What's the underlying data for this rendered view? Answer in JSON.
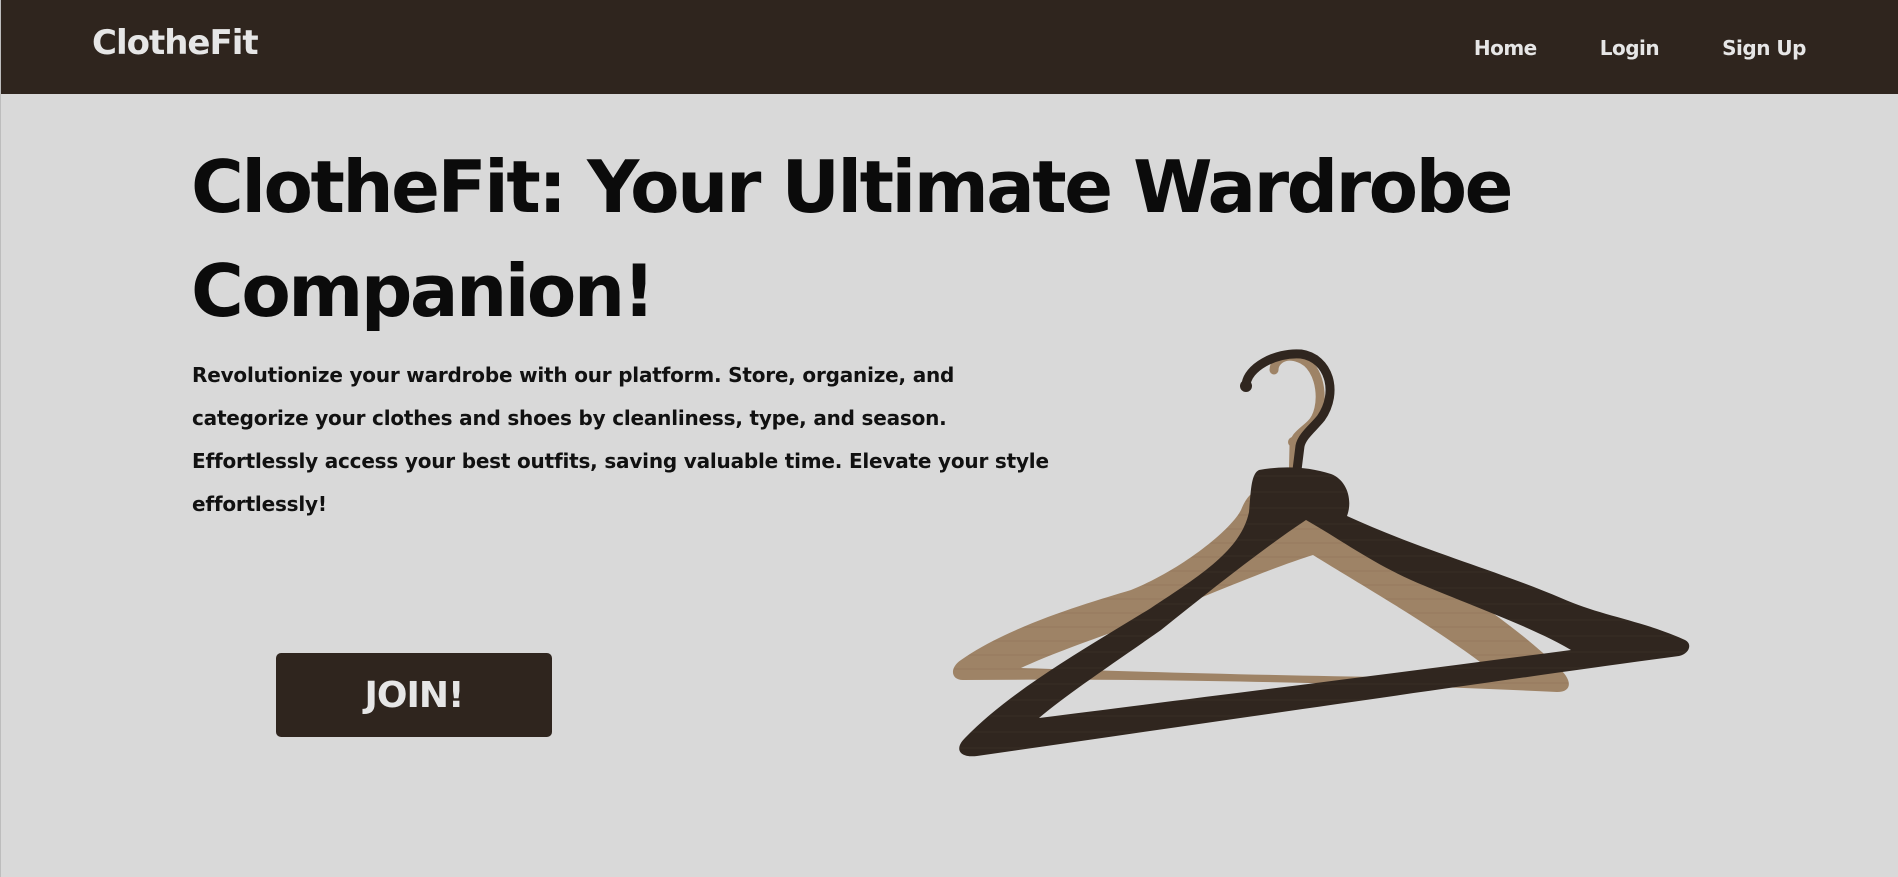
{
  "navbar": {
    "brand": "ClotheFit",
    "links": [
      {
        "label": "Home"
      },
      {
        "label": "Login"
      },
      {
        "label": "Sign Up"
      }
    ]
  },
  "hero": {
    "title": "ClotheFit: Your Ultimate Wardrobe Companion!",
    "description": "Revolutionize your wardrobe with our platform. Store, organize, and categorize your clothes and shoes by cleanliness, type, and season. Effortlessly access your best outfits, saving valuable time. Elevate your style effortlessly!",
    "cta_label": "JOIN!"
  },
  "colors": {
    "navbar_bg": "#2f251e",
    "page_bg": "#d9d9d9",
    "nav_text": "#e6e6e6",
    "hanger_dark": "#30261f",
    "hanger_light": "#9e8366"
  },
  "illustration": {
    "name": "clothes-hangers"
  }
}
